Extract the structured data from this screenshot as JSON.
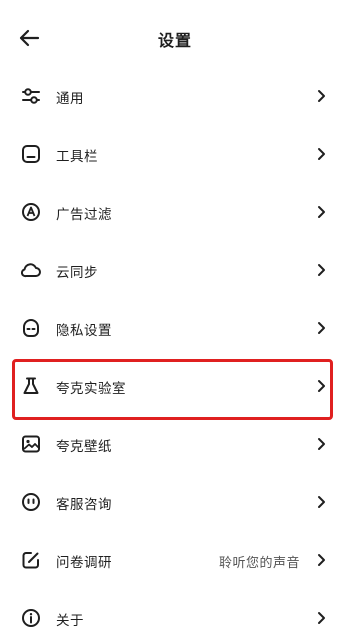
{
  "header": {
    "title": "设置",
    "back_icon": "arrow-left-icon"
  },
  "items": [
    {
      "label": "通用",
      "icon": "sliders-icon",
      "value": ""
    },
    {
      "label": "工具栏",
      "icon": "toolbar-icon",
      "value": ""
    },
    {
      "label": "广告过滤",
      "icon": "ad-block-icon",
      "value": ""
    },
    {
      "label": "云同步",
      "icon": "cloud-icon",
      "value": ""
    },
    {
      "label": "隐私设置",
      "icon": "privacy-mask-icon",
      "value": ""
    },
    {
      "label": "夸克实验室",
      "icon": "flask-icon",
      "value": "",
      "highlighted": true
    },
    {
      "label": "夸克壁纸",
      "icon": "wallpaper-icon",
      "value": ""
    },
    {
      "label": "客服咨询",
      "icon": "support-face-icon",
      "value": ""
    },
    {
      "label": "问卷调研",
      "icon": "survey-edit-icon",
      "value": "聆听您的声音"
    },
    {
      "label": "关于",
      "icon": "info-icon",
      "value": ""
    }
  ],
  "colors": {
    "highlight_border": "#e02020",
    "text": "#1f1f1f",
    "secondary_text": "#555555"
  }
}
